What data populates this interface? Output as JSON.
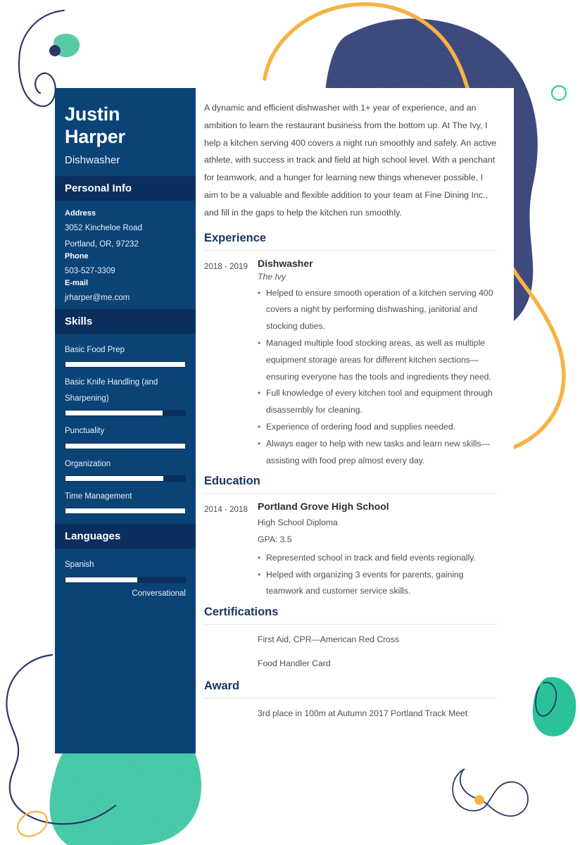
{
  "theme": {
    "sidebar_bg": "#0b4377",
    "sidebar_header_bg": "#0a2f5c",
    "heading_color": "#17355f",
    "navy_accent": "#2b3668",
    "teal_accent": "#3ed6ae",
    "orange_accent": "#f5b343",
    "text_color": "#4b4f55"
  },
  "sidebar": {
    "first_name": "Justin",
    "last_name": "Harper",
    "job_title": "Dishwasher",
    "personal_info": {
      "heading": "Personal Info",
      "fields": [
        {
          "label": "Address",
          "values": [
            "3052 Kincheloe Road",
            "Portland, OR, 97232"
          ]
        },
        {
          "label": "Phone",
          "values": [
            "503-527-3309"
          ]
        },
        {
          "label": "E-mail",
          "values": [
            "jrharper@me.com"
          ]
        }
      ]
    },
    "skills": {
      "heading": "Skills",
      "items": [
        {
          "name": "Basic Food Prep",
          "level": 100
        },
        {
          "name": "Basic Knife Handling (and Sharpening)",
          "level": 81
        },
        {
          "name": "Punctuality",
          "level": 100
        },
        {
          "name": "Organization",
          "level": 82
        },
        {
          "name": "Time Management",
          "level": 100
        }
      ]
    },
    "languages": {
      "heading": "Languages",
      "items": [
        {
          "name": "Spanish",
          "level": 60,
          "proficiency": "Conversational"
        }
      ]
    }
  },
  "main": {
    "summary": "A dynamic and efficient dishwasher with 1+ year of experience, and an ambition to learn the restaurant business from the bottom up. At The Ivy, I help a kitchen serving 400 covers a night run smoothly and safely. An active athlete, with success in track and field at high school level. With a penchant for teamwork, and a hunger for learning new things whenever possible, I aim to be a valuable and flexible addition to your team at Fine Dining Inc., and fill in the gaps to help the kitchen run smoothly.",
    "experience": {
      "heading": "Experience",
      "entries": [
        {
          "date": "2018 - 2019",
          "title": "Dishwasher",
          "org": "The Ivy",
          "bullets": [
            "Helped to ensure smooth operation of a kitchen serving 400 covers a night by performing dishwashing, janitorial and stocking duties.",
            "Managed multiple food stocking areas, as well as multiple equipment storage areas for different kitchen sections—ensuring everyone has the tools and ingredients they need.",
            "Full knowledge of every kitchen tool and equipment through disassembly for cleaning.",
            "Experience of ordering food and supplies needed.",
            "Always eager to help with new tasks and learn new skills—assisting with food prep almost every day."
          ]
        }
      ]
    },
    "education": {
      "heading": "Education",
      "entries": [
        {
          "date": "2014 - 2018",
          "title": "Portland Grove High School",
          "sub1": "High School Diploma",
          "sub2": "GPA: 3.5",
          "bullets": [
            "Represented school in track and field events regionally.",
            "Helped with organizing 3 events for parents, gaining teamwork and customer service skills."
          ]
        }
      ]
    },
    "certifications": {
      "heading": "Certifications",
      "items": [
        "First Aid, CPR—American Red Cross",
        "Food Handler Card"
      ]
    },
    "award": {
      "heading": "Award",
      "items": [
        "3rd place in 100m at Autumn 2017 Portland Track Meet"
      ]
    }
  }
}
